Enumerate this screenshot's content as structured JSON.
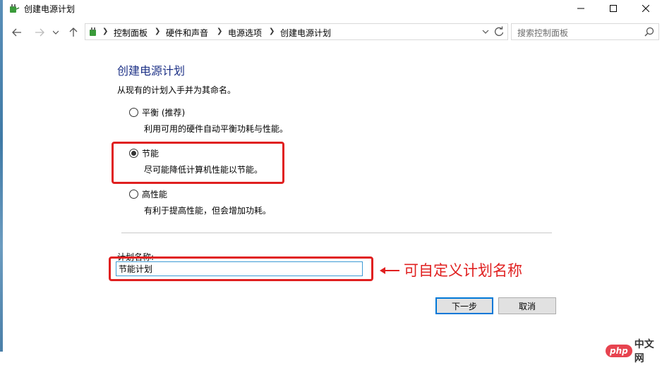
{
  "window": {
    "title": "创建电源计划",
    "minimize": "minimize",
    "maximize": "maximize",
    "close": "close"
  },
  "nav": {
    "breadcrumbs": [
      "控制面板",
      "硬件和声音",
      "电源选项",
      "创建电源计划"
    ],
    "search_placeholder": "搜索控制面板"
  },
  "content": {
    "heading": "创建电源计划",
    "intro": "从现有的计划入手并为其命名。",
    "options": [
      {
        "label": "平衡 (推荐)",
        "desc": "利用可用的硬件自动平衡功耗与性能。",
        "selected": false
      },
      {
        "label": "节能",
        "desc": "尽可能降低计算机性能以节能。",
        "selected": true
      },
      {
        "label": "高性能",
        "desc": "有利于提高性能，但会增加功耗。",
        "selected": false
      }
    ],
    "plan_name_label": "计划名称:",
    "plan_name_value": "节能计划",
    "next_button": "下一步",
    "cancel_button": "取消"
  },
  "annotation": {
    "text": "可自定义计划名称",
    "color": "#e02020"
  },
  "watermark": {
    "logo": "php",
    "text": "中文网"
  },
  "colors": {
    "heading": "#1e3287",
    "input_focus": "#3e9ad5",
    "primary_border": "#0078d7"
  }
}
